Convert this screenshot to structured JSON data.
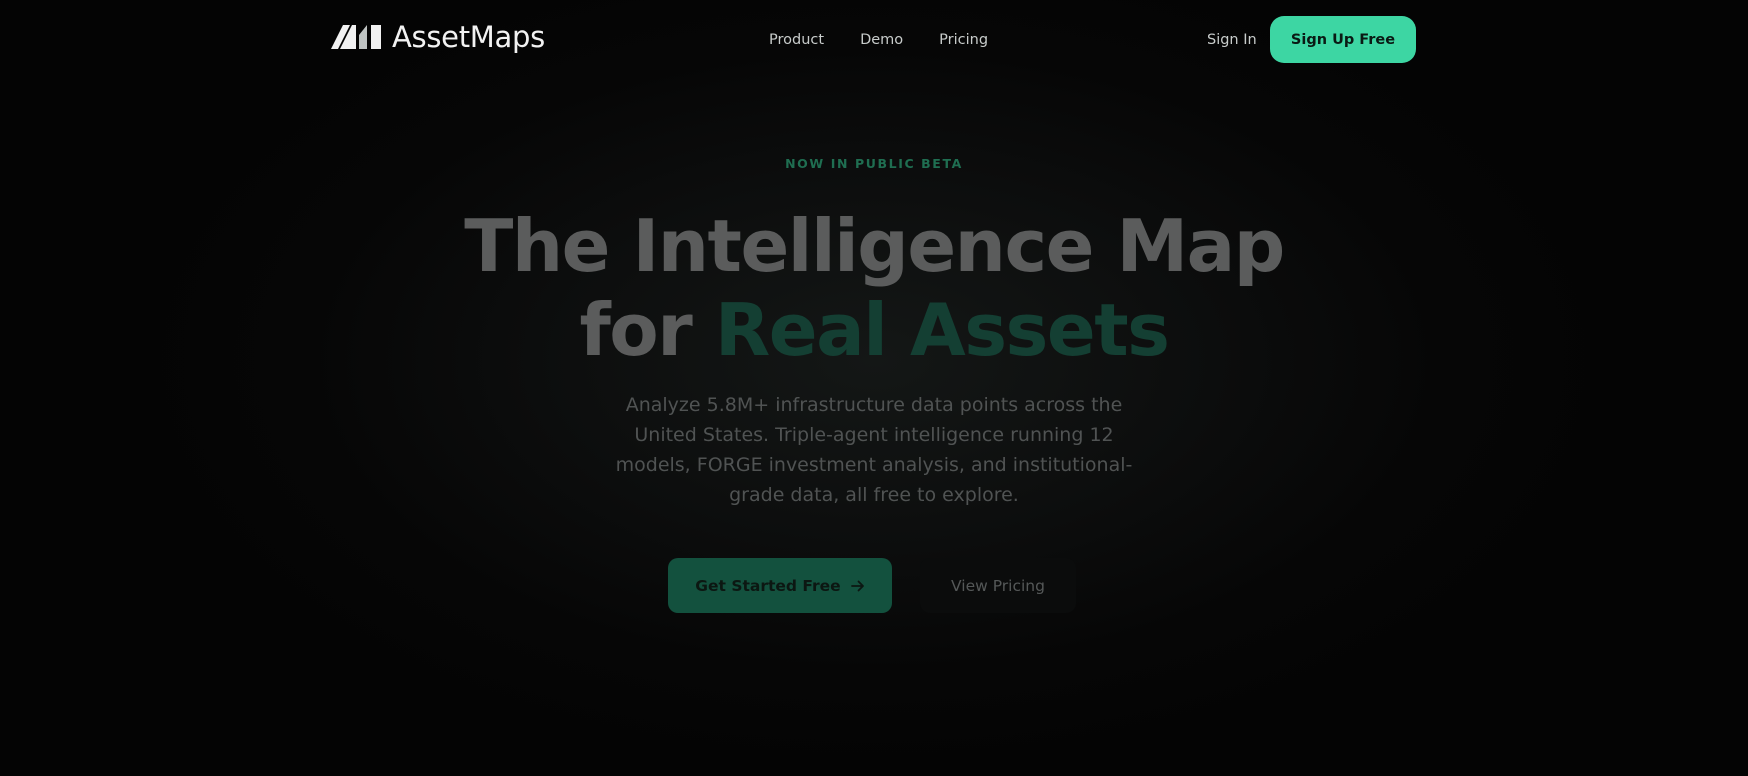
{
  "brand": {
    "name": "AssetMaps",
    "logo_icon": "assetmaps-logo-icon"
  },
  "nav": {
    "links": [
      {
        "label": "Product"
      },
      {
        "label": "Demo"
      },
      {
        "label": "Pricing"
      }
    ],
    "sign_in": "Sign In",
    "sign_up": "Sign Up Free"
  },
  "hero": {
    "eyebrow": "NOW IN PUBLIC BETA",
    "headline_line1": "The Intelligence Map",
    "headline_line2_prefix": "for ",
    "headline_line2_accent": "Real Assets",
    "subtext": "Analyze 5.8M+ infrastructure data points across the United States. Triple-agent intelligence running 12 models, FORGE investment analysis, and institutional-grade data, all free to explore.",
    "primary_cta": "Get Started Free",
    "primary_cta_icon": "arrow-right-icon",
    "secondary_cta": "View Pricing"
  },
  "colors": {
    "accent": "#3dd6a3",
    "background": "#050505"
  }
}
